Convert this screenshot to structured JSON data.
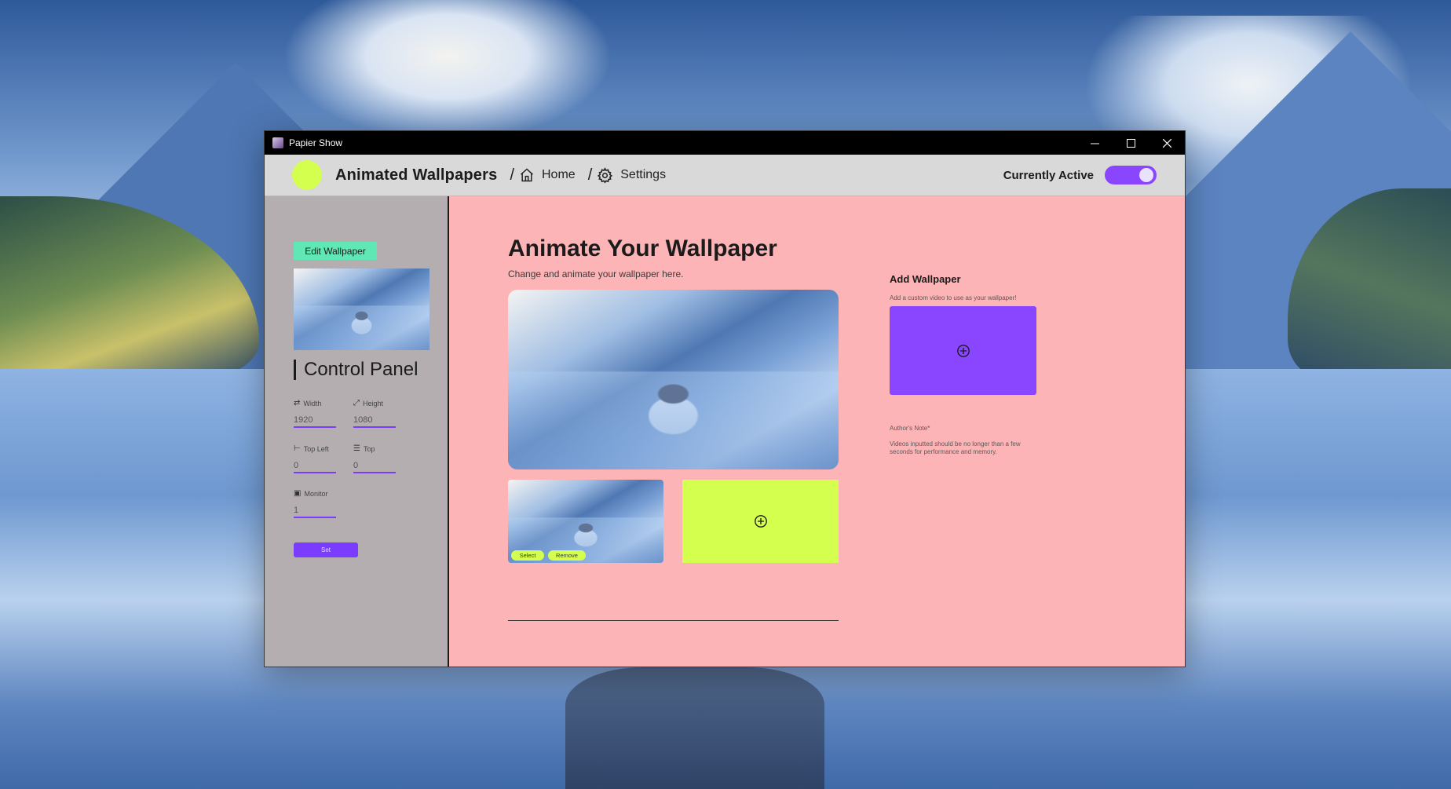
{
  "window": {
    "title": "Papier Show",
    "controls": [
      "minimize-icon",
      "maximize-icon",
      "close-icon"
    ]
  },
  "header": {
    "brand": "Animated Wallpapers",
    "separator": "/",
    "breadcrumbs": [
      {
        "label": "Home",
        "icon": "home-icon"
      },
      {
        "label": "Settings",
        "icon": "gear-icon"
      }
    ],
    "active_label": "Currently Active",
    "active_on": true
  },
  "sidebar": {
    "edit_label": "Edit Wallpaper",
    "panel_title": "Control Panel",
    "fields": {
      "width": {
        "label": "Width",
        "value": "1920"
      },
      "height": {
        "label": "Height",
        "value": "1080"
      },
      "top_left": {
        "label": "Top Left",
        "value": "0"
      },
      "top": {
        "label": "Top",
        "value": "0"
      },
      "monitor": {
        "label": "Monitor",
        "value": "1"
      }
    },
    "set_label": "Set"
  },
  "main": {
    "title": "Animate Your Wallpaper",
    "subtitle": "Change and animate your wallpaper here.",
    "thumb_select": "Select",
    "thumb_remove": "Remove",
    "add_icon": "plus-circle-icon"
  },
  "add_panel": {
    "title": "Add Wallpaper",
    "subtitle": "Add a custom video to use as your wallpaper!",
    "note_title": "Author's Note*",
    "note_text": "Videos inputted should be no longer than a few seconds for performance and memory."
  },
  "colors": {
    "accent_purple": "#8a45ff",
    "accent_lime": "#d4ff4f",
    "accent_mint": "#5fe8b5",
    "main_bg": "#fdb4b6",
    "sidebar_bg": "#b4aeb0"
  }
}
